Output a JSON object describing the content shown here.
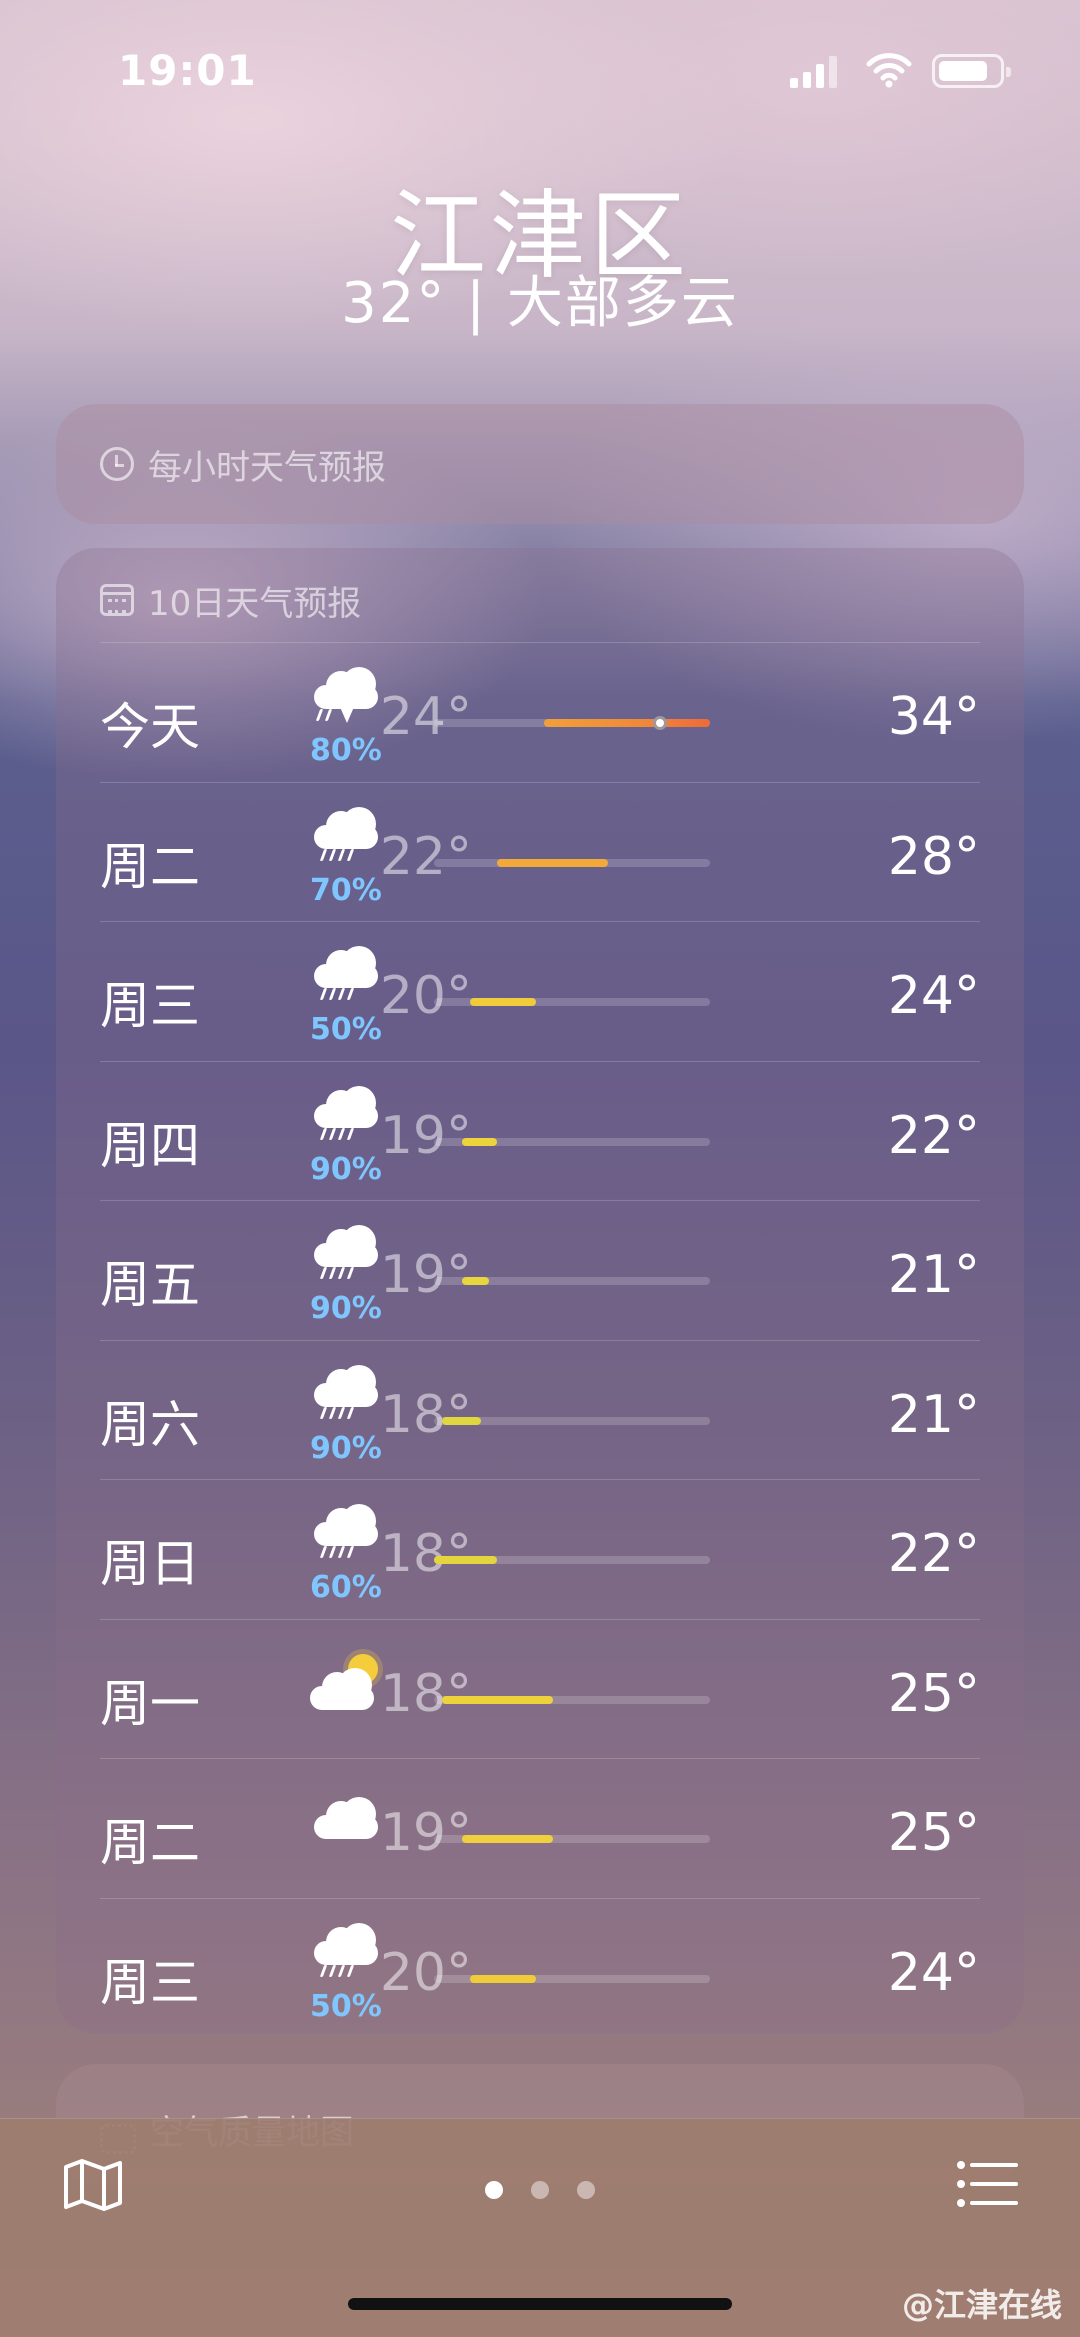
{
  "status_bar": {
    "time": "19:01"
  },
  "header": {
    "city": "江津区",
    "summary": "32° | 大部多云"
  },
  "hourly": {
    "title": "每小时天气预报",
    "icon": "clock-icon"
  },
  "forecast": {
    "title": "10日天气预报",
    "icon": "calendar-icon",
    "days": [
      {
        "day": "今天",
        "icon": "thunderstorm-icon",
        "precip": "80%",
        "low": "24°",
        "high": "34°",
        "bar_start": 0.4,
        "bar_end": 1.0,
        "current_marker": 0.82,
        "bar_color": "#f0883a"
      },
      {
        "day": "周二",
        "icon": "rain-cloud-icon",
        "precip": "70%",
        "low": "22°",
        "high": "28°",
        "bar_start": 0.23,
        "bar_end": 0.63,
        "bar_color": "#f1a93a"
      },
      {
        "day": "周三",
        "icon": "rain-cloud-icon",
        "precip": "50%",
        "low": "20°",
        "high": "24°",
        "bar_start": 0.13,
        "bar_end": 0.37,
        "bar_color": "#f0cc3a"
      },
      {
        "day": "周四",
        "icon": "rain-cloud-icon",
        "precip": "90%",
        "low": "19°",
        "high": "22°",
        "bar_start": 0.1,
        "bar_end": 0.23,
        "bar_color": "#eed43c"
      },
      {
        "day": "周五",
        "icon": "rain-cloud-icon",
        "precip": "90%",
        "low": "19°",
        "high": "21°",
        "bar_start": 0.1,
        "bar_end": 0.2,
        "bar_color": "#e8d63e"
      },
      {
        "day": "周六",
        "icon": "rain-cloud-icon",
        "precip": "90%",
        "low": "18°",
        "high": "21°",
        "bar_start": 0.03,
        "bar_end": 0.17,
        "bar_color": "#e0d640"
      },
      {
        "day": "周日",
        "icon": "rain-cloud-icon",
        "precip": "60%",
        "low": "18°",
        "high": "22°",
        "bar_start": 0.0,
        "bar_end": 0.23,
        "bar_color": "#e4d43e"
      },
      {
        "day": "周一",
        "icon": "partly-sunny-icon",
        "precip": "",
        "low": "18°",
        "high": "25°",
        "bar_start": 0.03,
        "bar_end": 0.43,
        "bar_color": "#eed23c"
      },
      {
        "day": "周二",
        "icon": "cloud-icon",
        "precip": "",
        "low": "19°",
        "high": "25°",
        "bar_start": 0.1,
        "bar_end": 0.43,
        "bar_color": "#f0d03c"
      },
      {
        "day": "周三",
        "icon": "rain-cloud-icon",
        "precip": "50%",
        "low": "20°",
        "high": "24°",
        "bar_start": 0.13,
        "bar_end": 0.37,
        "bar_color": "#f0cc3a"
      }
    ]
  },
  "air_quality": {
    "title": "空气质量地图"
  },
  "bottom_bar": {
    "map": "map-icon",
    "list": "list-icon",
    "page_count": 3,
    "active_page": 0
  },
  "watermark": "@江津在线"
}
